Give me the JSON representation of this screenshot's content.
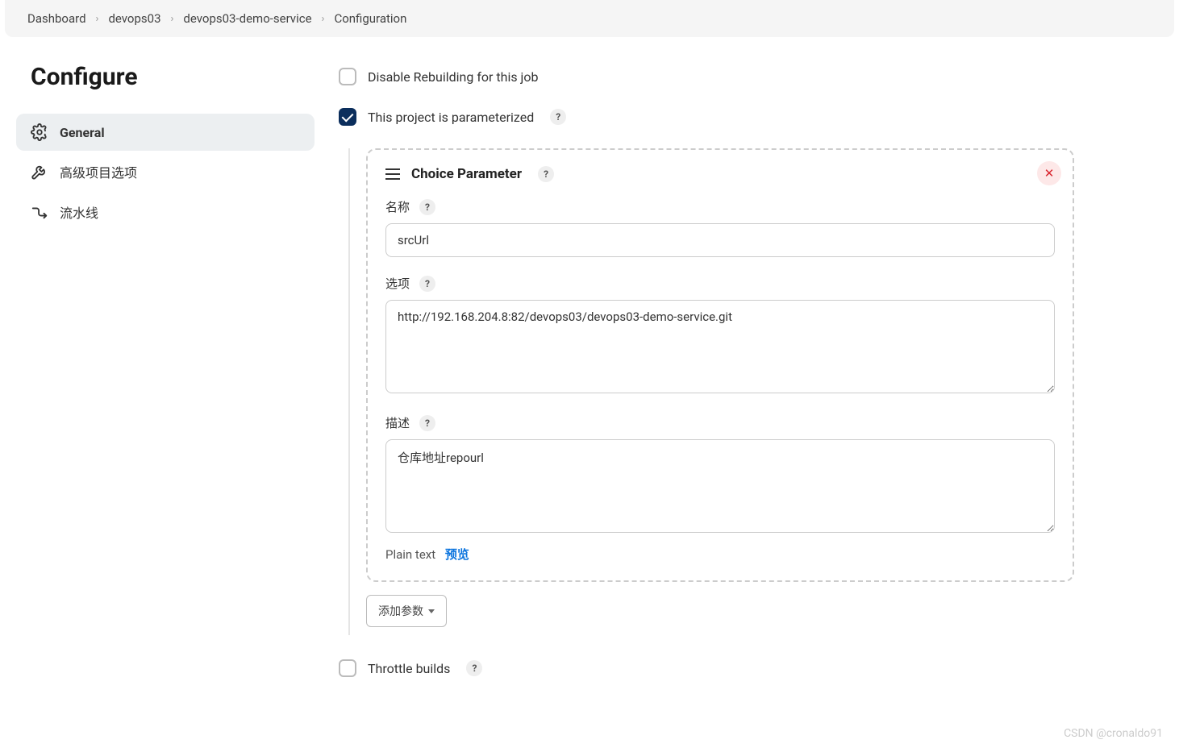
{
  "breadcrumb": {
    "items": [
      "Dashboard",
      "devops03",
      "devops03-demo-service",
      "Configuration"
    ]
  },
  "page": {
    "title": "Configure"
  },
  "sidebar": {
    "items": [
      {
        "label": "General"
      },
      {
        "label": "高级项目选项"
      },
      {
        "label": "流水线"
      }
    ]
  },
  "options": {
    "disable_rebuild_label": "Disable Rebuilding for this job",
    "parameterized_label": "This project is parameterized",
    "throttle_label": "Throttle builds"
  },
  "parameter": {
    "type_title": "Choice Parameter",
    "name_label": "名称",
    "name_value": "srcUrl",
    "choices_label": "选项",
    "choices_value": "http://192.168.204.8:82/devops03/devops03-demo-service.git",
    "desc_label": "描述",
    "desc_value": "仓库地址repourl",
    "format_label": "Plain text",
    "preview_link": "预览"
  },
  "buttons": {
    "add_param": "添加参数"
  },
  "watermark": "CSDN @cronaldo91"
}
